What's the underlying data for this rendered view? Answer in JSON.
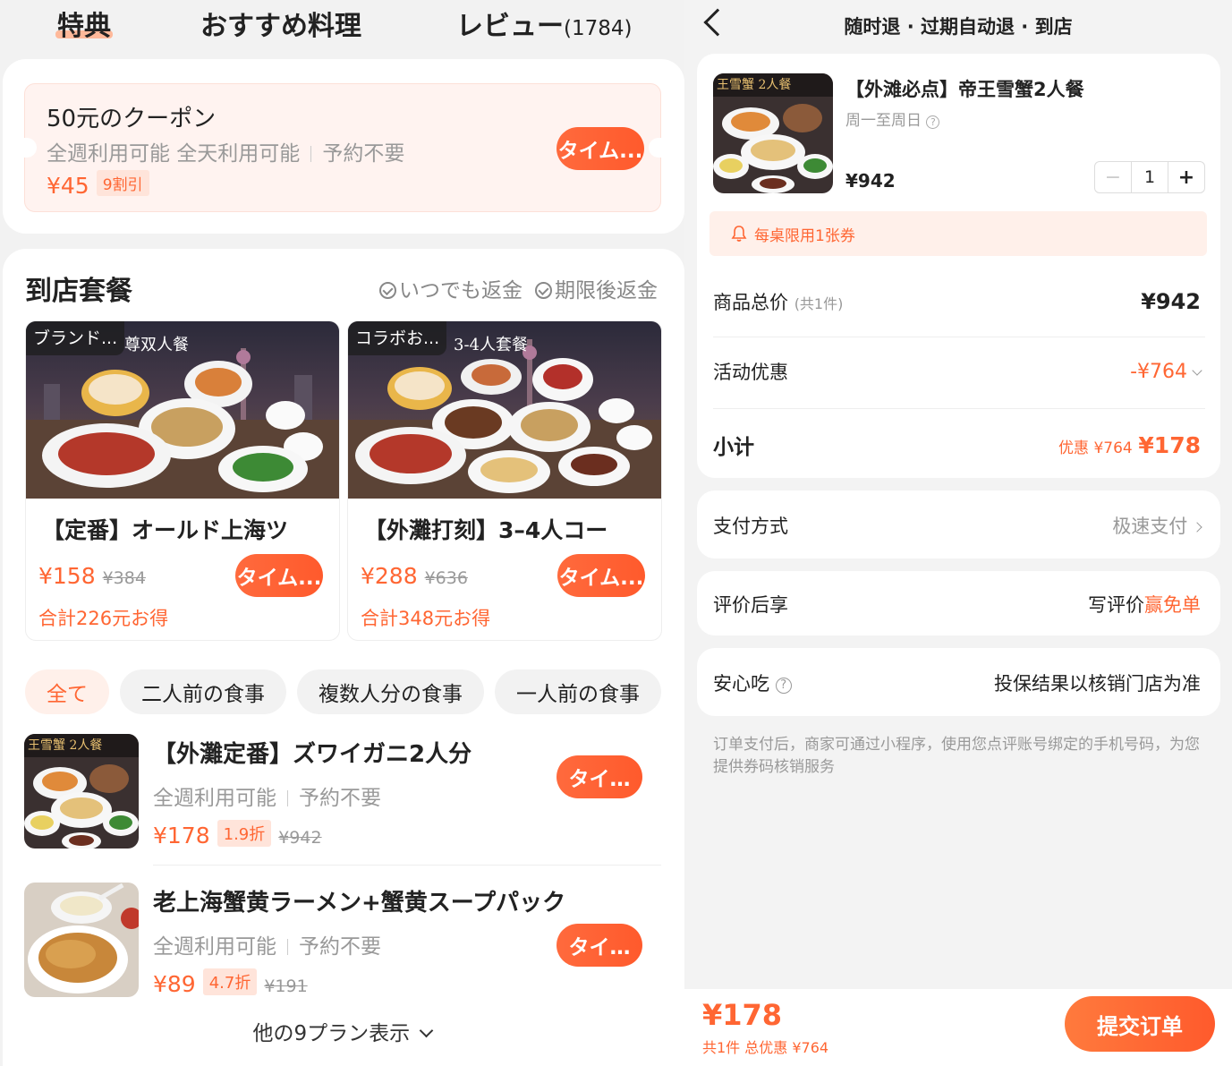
{
  "left": {
    "tabs": [
      {
        "label": "特典",
        "active": true
      },
      {
        "label": "おすすめ料理"
      },
      {
        "label": "レビュー",
        "count": "(1784)"
      }
    ],
    "coupon": {
      "title": "50元のクーポン",
      "subtitle_a": "全週利用可能 全天利用可能",
      "subtitle_b": "予約不要",
      "price": "¥45",
      "discount": "9割引",
      "button": "タイム..."
    },
    "package_section": {
      "title": "到店套餐",
      "tag_a": "いつでも返金",
      "tag_b": "期限後返金"
    },
    "package_cards": [
      {
        "tag": "ブランド...",
        "image_text": "尊双人餐",
        "title": "【定番】オールド上海ツ",
        "price": "¥158",
        "orig_price": "¥384",
        "save": "合計226元お得",
        "button": "タイム..."
      },
      {
        "tag": "コラボお...",
        "image_text": "3-4人套餐",
        "title": "【外灘打刻】3–4人コー",
        "price": "¥288",
        "orig_price": "¥636",
        "save": "合計348元お得",
        "button": "タイム..."
      }
    ],
    "filters": [
      "全て",
      "二人前の食事",
      "複数人分の食事",
      "一人前の食事"
    ],
    "items": [
      {
        "title": "【外灘定番】ズワイガニ2人分",
        "sub_a": "全週利用可能",
        "sub_b": "予約不要",
        "price": "¥178",
        "discount": "1.9折",
        "orig": "¥942",
        "button": "タイ…",
        "image_text": "王雪蟹 2人餐"
      },
      {
        "title": "老上海蟹黄ラーメン+蟹黄スープパック",
        "sub_a": "全週利用可能",
        "sub_b": "予約不要",
        "price": "¥89",
        "discount": "4.7折",
        "orig": "¥191",
        "button": "タイ…"
      }
    ],
    "more": "他の9プラン表示"
  },
  "right": {
    "header": "随时退 · 过期自动退 · 到店",
    "product": {
      "image_text": "王雪蟹 2人餐",
      "title": "【外滩必点】帝王雪蟹2人餐",
      "subtitle": "周一至周日",
      "price": "¥942",
      "qty": "1",
      "notice": "每桌限用1张券"
    },
    "summary": {
      "total_label": "商品总价",
      "total_count": "(共1件)",
      "total_value": "¥942",
      "promo_label": "活动优惠",
      "promo_value": "-¥764",
      "subtotal_label": "小计",
      "subtotal_save": "优惠 ¥764",
      "subtotal_value": "¥178"
    },
    "payment": {
      "label": "支付方式",
      "value": "极速支付"
    },
    "review": {
      "label": "评价后享",
      "value_a": "写评价",
      "value_b": "赢免单"
    },
    "safe": {
      "label": "安心吃",
      "value": "投保结果以核销门店为准"
    },
    "footnote": "订单支付后，商家可通过小程序，使用您点评账号绑定的手机号码，为您提供券码核销服务",
    "bottom": {
      "price": "¥178",
      "detail": "共1件 总优惠 ¥764",
      "submit": "提交订单"
    }
  },
  "colors": {
    "accent": "#ff6633",
    "background": "#f2f2f2"
  }
}
